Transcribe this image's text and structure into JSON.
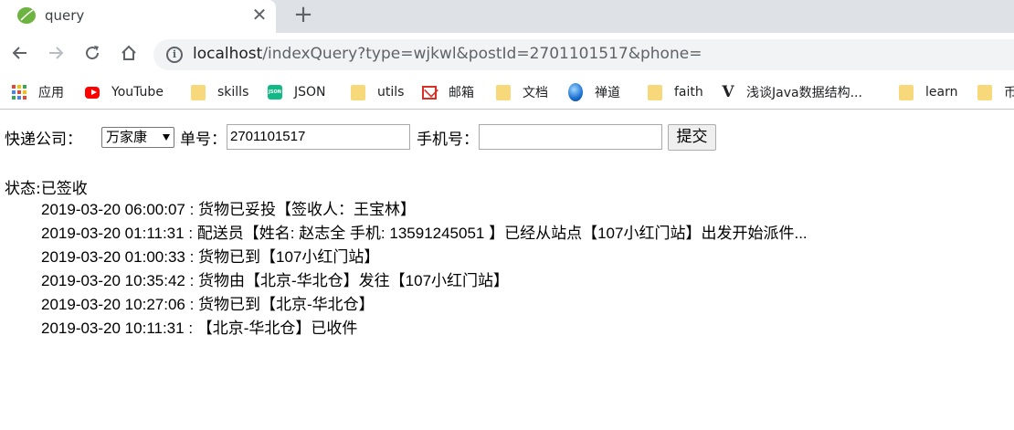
{
  "browser": {
    "tab_title": "query",
    "url_host": "localhost",
    "url_path": "/indexQuery?type=wjkwl&postId=2701101517&phone=",
    "bookmarks": [
      {
        "label": "应用",
        "icon": "apps-icon"
      },
      {
        "label": "YouTube",
        "icon": "youtube-icon"
      },
      {
        "label": "skills",
        "icon": "folder-icon"
      },
      {
        "label": "JSON",
        "icon": "json-icon"
      },
      {
        "label": "utils",
        "icon": "folder-icon"
      },
      {
        "label": "邮箱",
        "icon": "mail-icon"
      },
      {
        "label": "文档",
        "icon": "folder-icon"
      },
      {
        "label": "禅道",
        "icon": "globe-icon"
      },
      {
        "label": "faith",
        "icon": "folder-icon"
      },
      {
        "label": "浅谈Java数据结构...",
        "icon": "site-logo-icon"
      },
      {
        "label": "learn",
        "icon": "folder-icon"
      },
      {
        "label": "币",
        "icon": "folder-icon"
      }
    ]
  },
  "form": {
    "company_label": "快递公司：",
    "company_selected": "万家康",
    "postid_label": "单号：",
    "postid_value": "2701101517",
    "phone_label": "手机号：",
    "phone_value": "",
    "submit_label": "提交"
  },
  "result": {
    "status": "状态:已签收",
    "records": [
      "2019-03-20 06:00:07 : 货物已妥投【签收人：王宝林】",
      "2019-03-20 01:11:31 : 配送员【姓名: 赵志全 手机: 13591245051 】已经从站点【107小红门站】出发开始派件...",
      "2019-03-20 01:00:33 : 货物已到【107小红门站】",
      "2019-03-20 10:35:42 : 货物由【北京-华北仓】发往【107小红门站】",
      "2019-03-20 10:27:06 : 货物已到【北京-华北仓】",
      "2019-03-20 10:11:31 : 【北京-华北仓】已收件"
    ]
  }
}
